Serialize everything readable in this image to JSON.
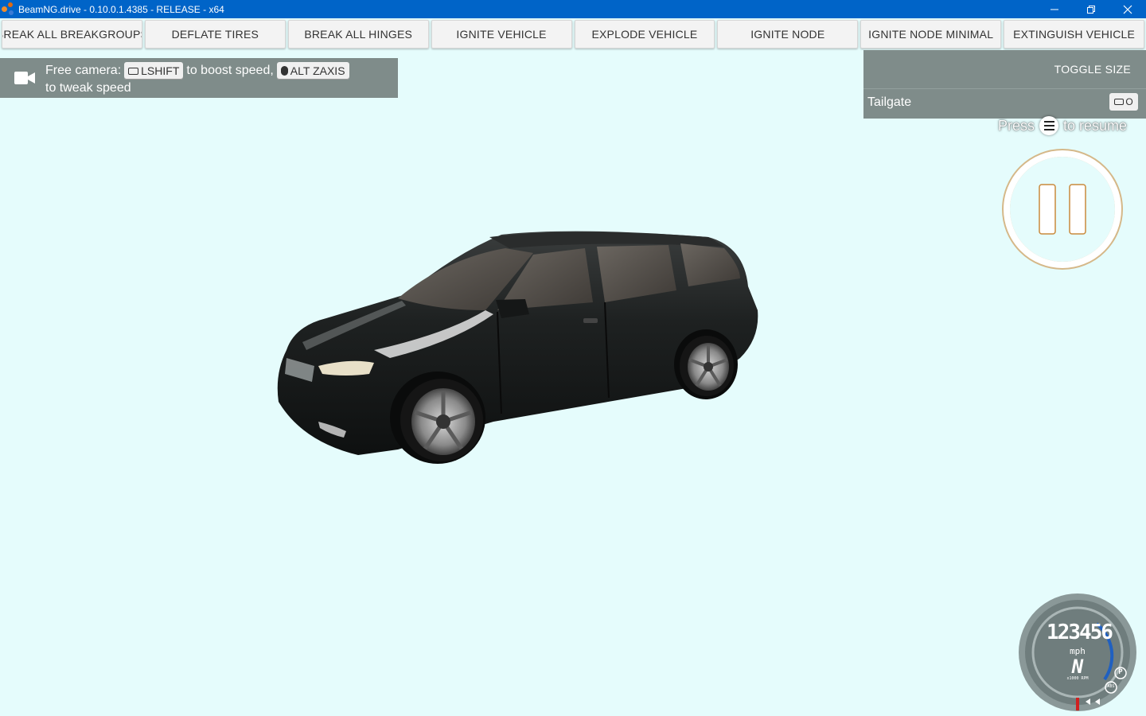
{
  "window": {
    "title": "BeamNG.drive - 0.10.0.1.4385 - RELEASE - x64",
    "minimize_glyph": "–",
    "restore_glyph": "❐",
    "close_glyph": "✕"
  },
  "toolbar": {
    "buttons": [
      "BREAK ALL BREAKGROUPS",
      "DEFLATE TIRES",
      "BREAK ALL HINGES",
      "IGNITE VEHICLE",
      "EXPLODE VEHICLE",
      "IGNITE NODE",
      "IGNITE NODE MINIMAL",
      "EXTINGUISH VEHICLE"
    ]
  },
  "camera_hint": {
    "prefix": "Free camera:",
    "key1": "LSHIFT",
    "mid": "to boost speed,",
    "key2": "ALT ZAXIS",
    "line2": "to tweak speed"
  },
  "side_panel": {
    "toggle_label": "TOGGLE SIZE",
    "item_label": "Tailgate",
    "item_key": "O"
  },
  "resume": {
    "before": "Press",
    "after": "to resume"
  },
  "gauge": {
    "gears": "123456",
    "unit": "mph",
    "gear": "N",
    "rpm_label": "x1000 RPM",
    "park": "P",
    "abs": "ABS"
  },
  "colors": {
    "titlebar": "#0064c8",
    "background": "#e5fcfc",
    "panel": "#7f8c8a",
    "pause_ring": "#c98a3c"
  }
}
